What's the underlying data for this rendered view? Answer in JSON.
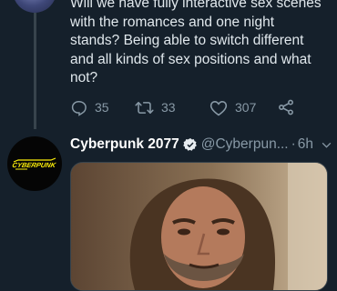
{
  "previous_tweet": {
    "text": "Will we have fully interactive sex scenes\nwith the romances and one night\nstands? Being able to switch different\nand all kinds of sex positions and what\nnot?",
    "actions": {
      "replies": "35",
      "retweets": "33",
      "likes": "307"
    }
  },
  "reply_tweet": {
    "author_name": "Cyberpunk 2077",
    "handle": "@Cyberpun...",
    "separator": "·",
    "time": "6h",
    "verified": true,
    "avatar_logo_text": "Cyberpunk"
  },
  "icons": {
    "reply": "reply-icon",
    "retweet": "retweet-icon",
    "like": "heart-icon",
    "share": "share-icon",
    "verified": "verified-badge-icon",
    "caret": "chevron-down-icon"
  },
  "colors": {
    "background": "#15202b",
    "text": "#e1e8ed",
    "secondary": "#8899a6",
    "divider": "#38444d",
    "logo_yellow": "#fcee0a"
  }
}
